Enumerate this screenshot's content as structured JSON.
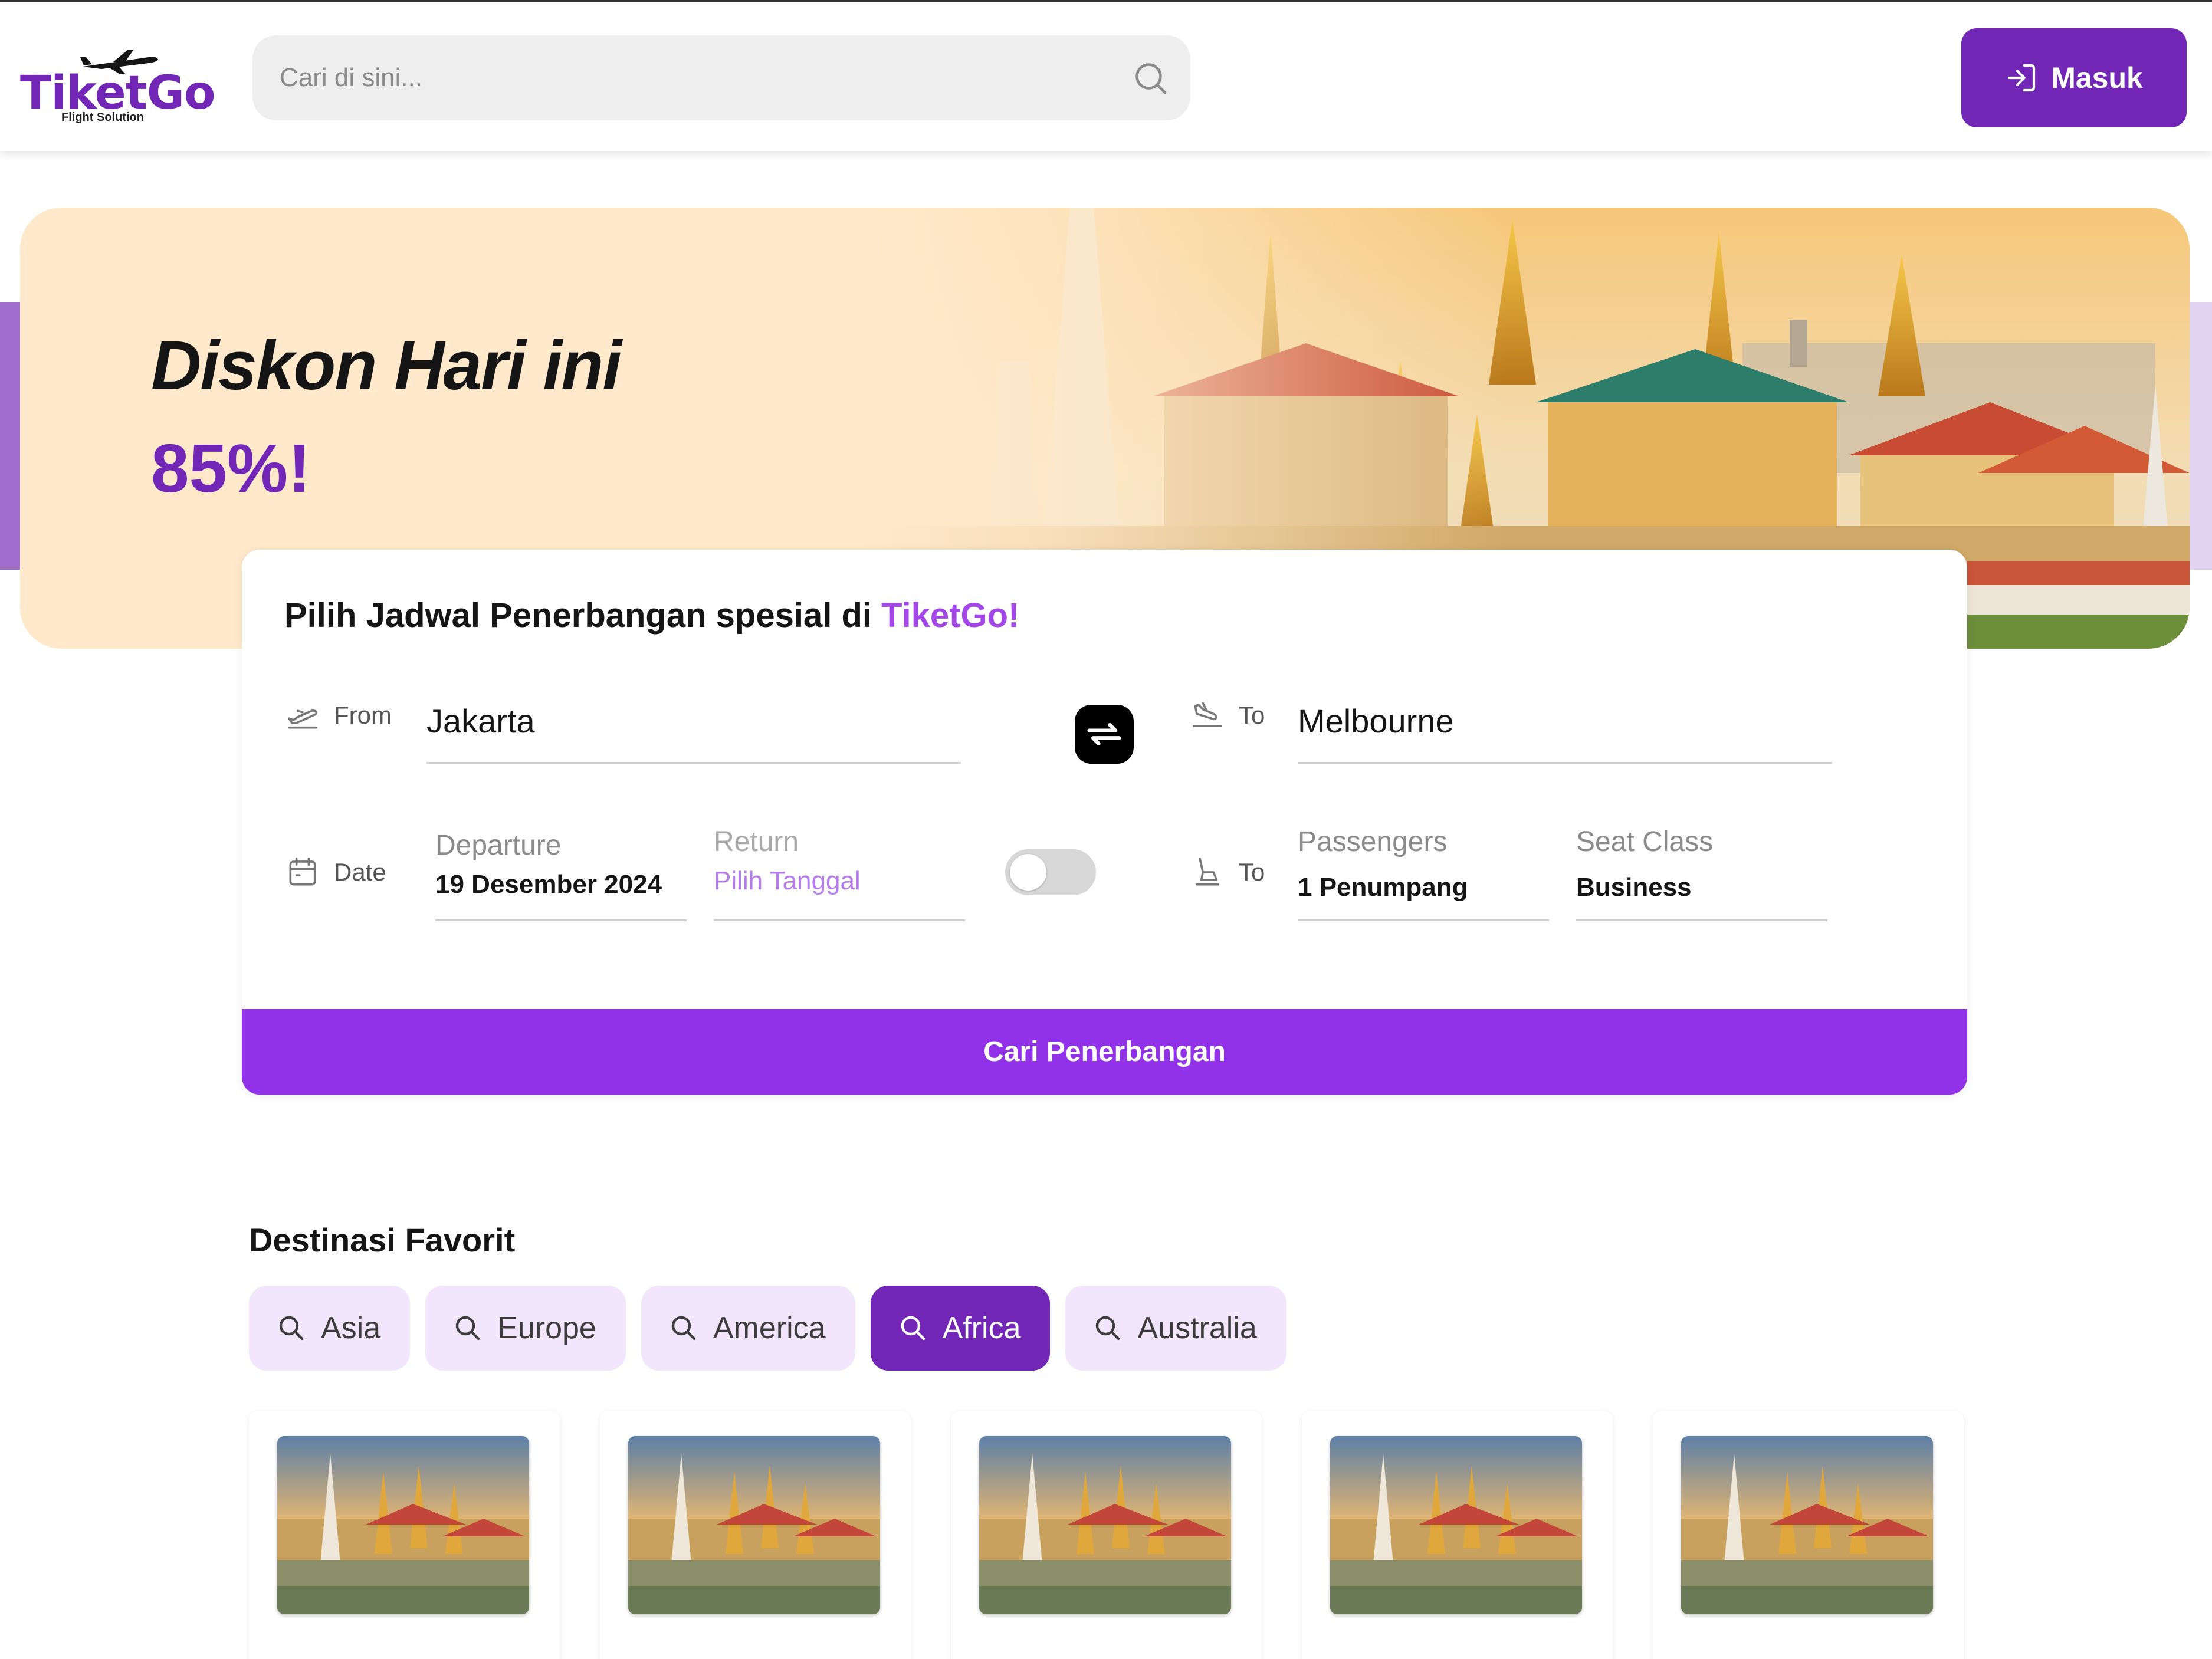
{
  "header": {
    "logo_text": "TiketGo",
    "logo_subtitle": "Flight Solution",
    "search_placeholder": "Cari di sini...",
    "login_label": "Masuk"
  },
  "hero": {
    "title": "Diskon Hari ini",
    "discount": "85%!"
  },
  "search_card": {
    "title_prefix": "Pilih Jadwal Penerbangan spesial di ",
    "title_brand": "TiketGo!",
    "from_label": "From",
    "from_value": "Jakarta",
    "to_label": "To",
    "to_value": "Melbourne",
    "date_label": "Date",
    "departure_label": "Departure",
    "departure_value": "19 Desember 2024",
    "return_label": "Return",
    "return_value": "Pilih Tanggal",
    "return_toggle_on": false,
    "passenger_label": "To",
    "passengers_label": "Passengers",
    "passengers_value": "1 Penumpang",
    "seat_class_label": "Seat Class",
    "seat_class_value": "Business",
    "submit_label": "Cari Penerbangan"
  },
  "favorites": {
    "title": "Destinasi Favorit",
    "chips": [
      {
        "label": "Asia",
        "active": false
      },
      {
        "label": "Europe",
        "active": false
      },
      {
        "label": "America",
        "active": false
      },
      {
        "label": "Africa",
        "active": true
      },
      {
        "label": "Australia",
        "active": false
      }
    ],
    "card_count_visible": 5
  },
  "colors": {
    "brand": "#7126B5",
    "button": "#9232E8",
    "hero_bg": "#FFE9CA",
    "chip_bg": "#F2E6FC"
  },
  "icons": {
    "search": "search-icon",
    "login": "login-icon",
    "takeoff": "plane-takeoff-icon",
    "landing": "plane-landing-icon",
    "swap": "swap-icon",
    "calendar": "calendar-icon",
    "seat": "seat-icon"
  }
}
